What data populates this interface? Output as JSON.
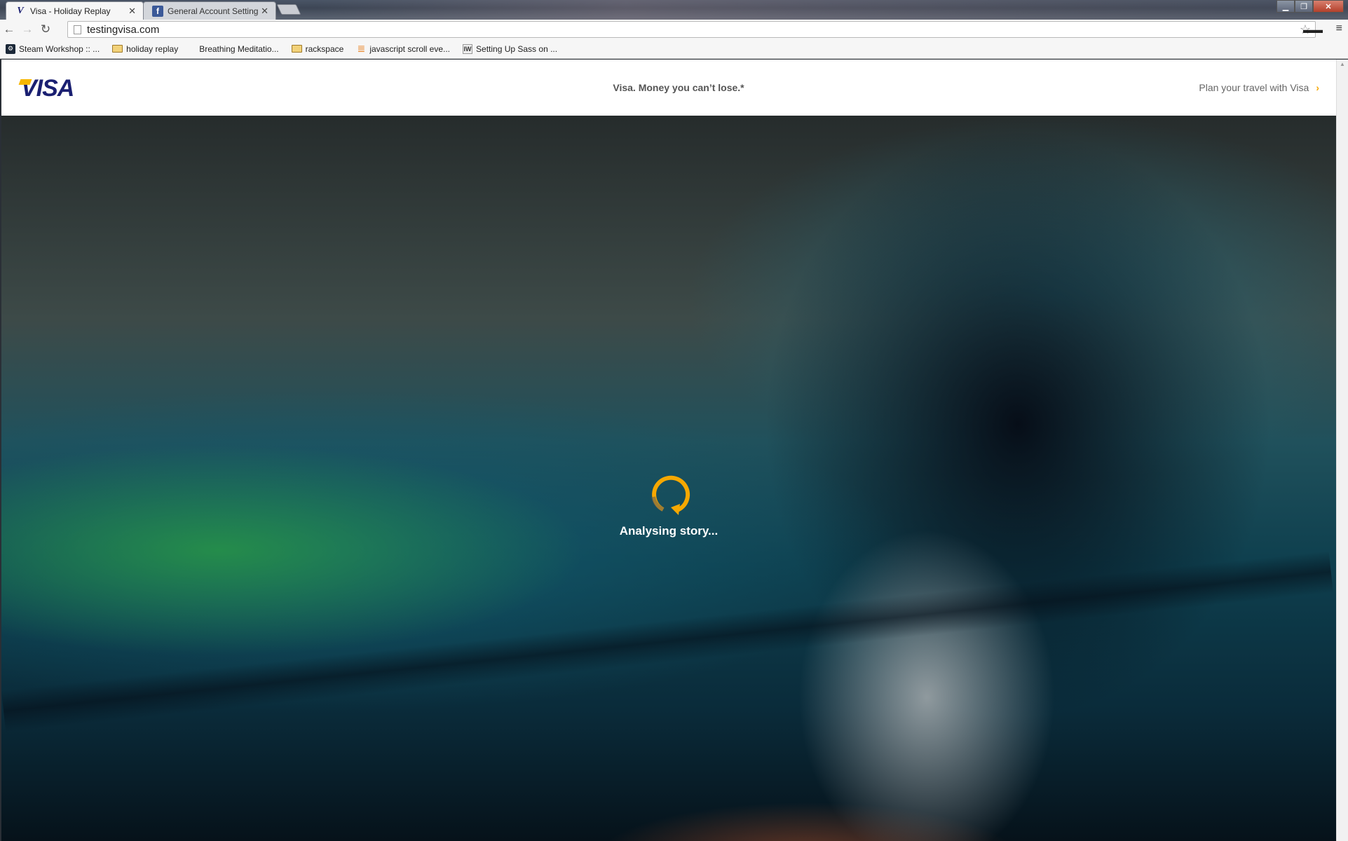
{
  "browser": {
    "tabs": [
      {
        "title": "Visa - Holiday Replay",
        "active": true,
        "favicon": "visa-icon"
      },
      {
        "title": "General Account Settings",
        "active": false,
        "favicon": "facebook-icon"
      }
    ],
    "address": "testingvisa.com",
    "bookmarks": [
      {
        "label": "Steam Workshop :: ...",
        "icon": "steam-icon"
      },
      {
        "label": "holiday replay",
        "icon": "folder-icon"
      },
      {
        "label": "Breathing Meditatio...",
        "icon": ""
      },
      {
        "label": "rackspace",
        "icon": "folder-icon"
      },
      {
        "label": "javascript scroll eve...",
        "icon": "stackoverflow-icon"
      },
      {
        "label": "Setting Up Sass on ...",
        "icon": "iw-icon"
      }
    ]
  },
  "site": {
    "logo": "VISA",
    "tagline": "Visa. Money you can’t lose.*",
    "plan_link": "Plan your travel with Visa",
    "loading_text": "Analysing story...",
    "accent_color": "#f7a800",
    "brand_color": "#1a1f71"
  }
}
